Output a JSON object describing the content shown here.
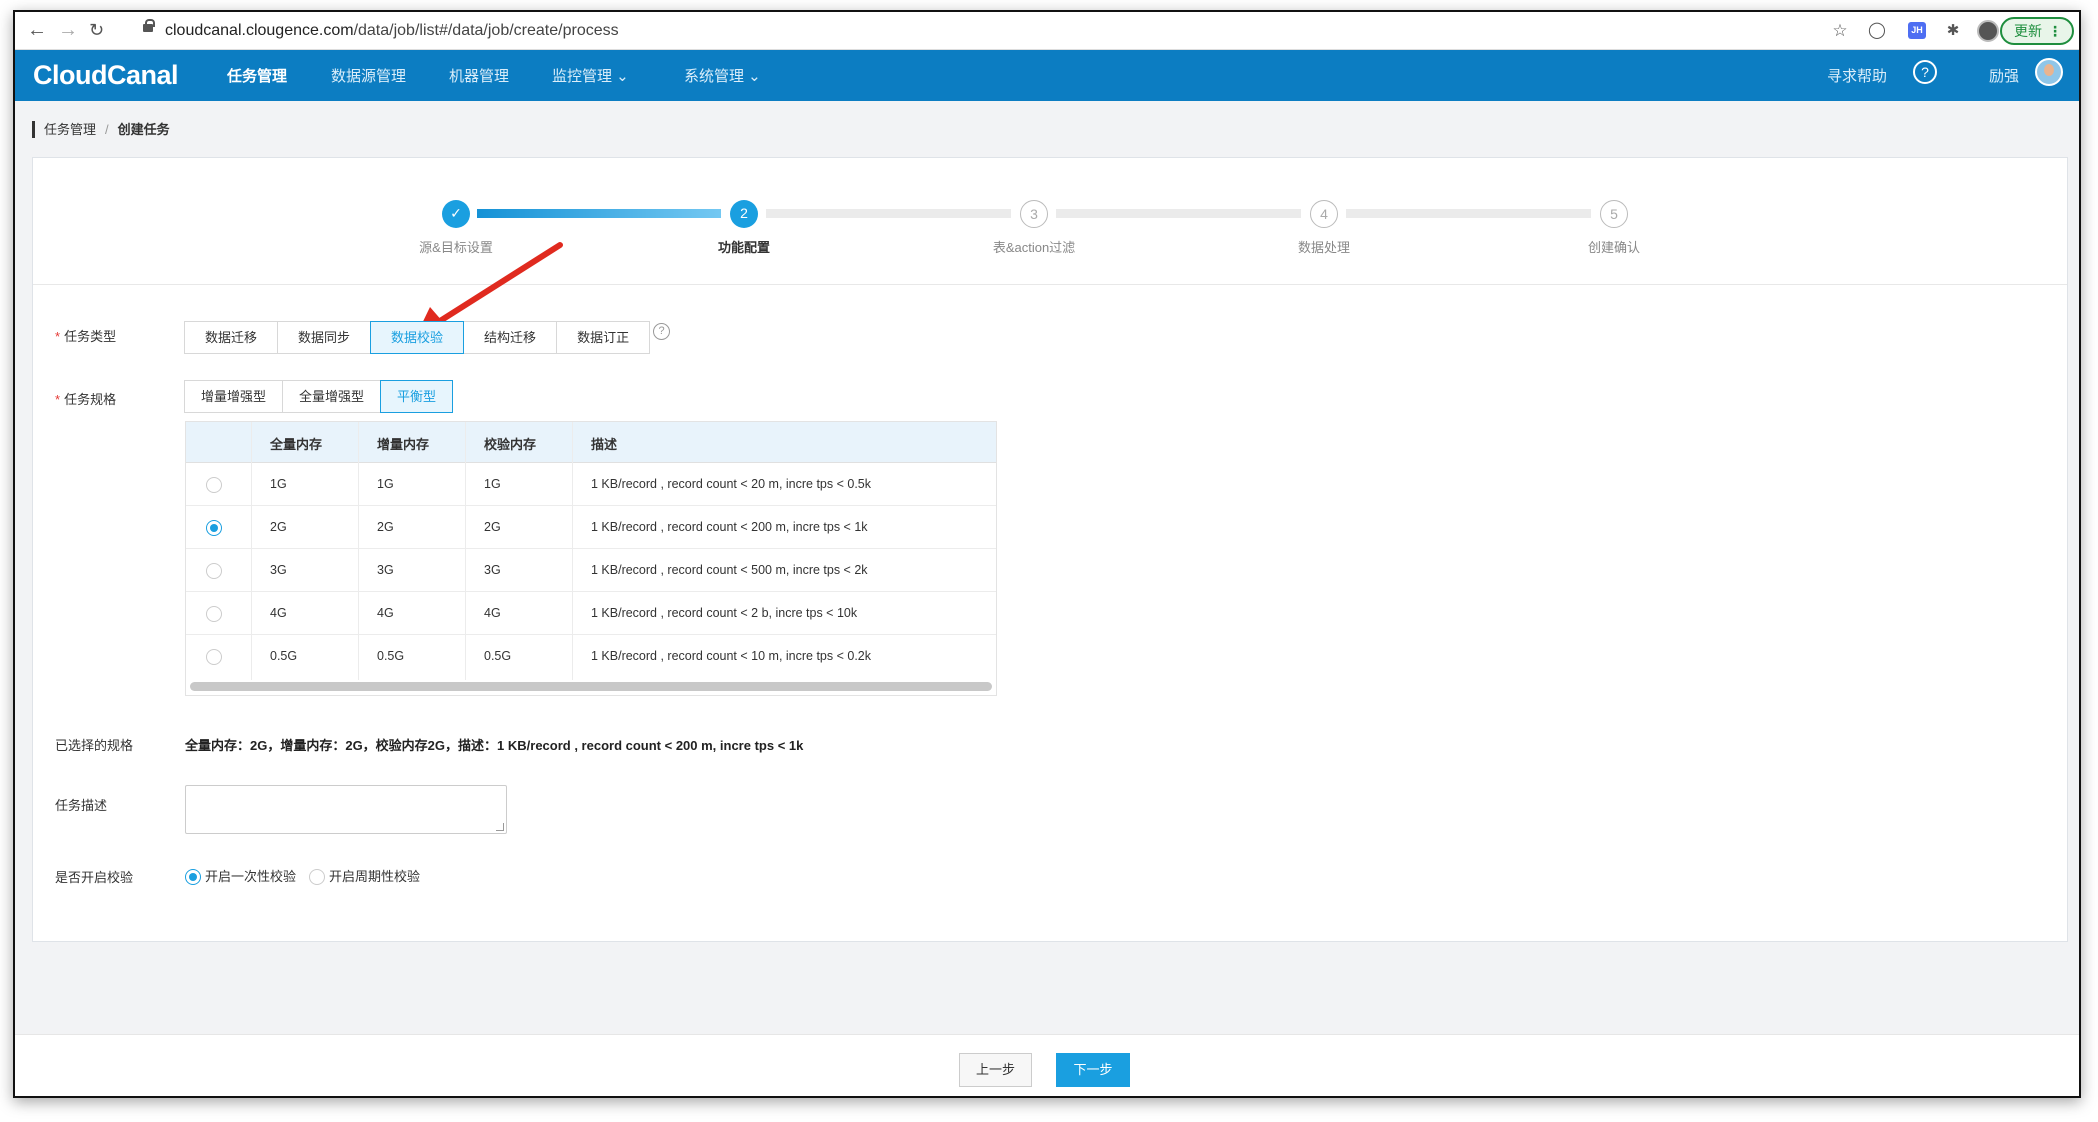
{
  "browser": {
    "url_host": "cloudcanal.clougence.com",
    "url_path": "/data/job/list#/data/job/create/process",
    "update_label": "更新"
  },
  "app": {
    "logo": "CloudCanal",
    "nav": [
      "任务管理",
      "数据源管理",
      "机器管理",
      "监控管理 ⌄",
      "系统管理 ⌄"
    ],
    "help_label": "寻求帮助",
    "user_name": "励强"
  },
  "breadcrumb": {
    "parent": "任务管理",
    "current": "创建任务"
  },
  "steps": [
    {
      "label": "源&目标设置",
      "num": "✓",
      "state": "done"
    },
    {
      "label": "功能配置",
      "num": "2",
      "state": "active"
    },
    {
      "label": "表&action过滤",
      "num": "3",
      "state": "todo"
    },
    {
      "label": "数据处理",
      "num": "4",
      "state": "todo"
    },
    {
      "label": "创建确认",
      "num": "5",
      "state": "todo"
    }
  ],
  "form": {
    "task_type_label": "任务类型",
    "task_types": [
      "数据迁移",
      "数据同步",
      "数据校验",
      "结构迁移",
      "数据订正"
    ],
    "task_type_selected": "数据校验",
    "task_spec_label": "任务规格",
    "task_specs": [
      "增量增强型",
      "全量增强型",
      "平衡型"
    ],
    "task_spec_selected": "平衡型",
    "table": {
      "headers": [
        "全量内存",
        "增量内存",
        "校验内存",
        "描述"
      ],
      "rows": [
        [
          "1G",
          "1G",
          "1G",
          "1 KB/record , record count < 20 m, incre tps < 0.5k"
        ],
        [
          "2G",
          "2G",
          "2G",
          "1 KB/record , record count < 200 m, incre tps < 1k"
        ],
        [
          "3G",
          "3G",
          "3G",
          "1 KB/record , record count < 500 m, incre tps < 2k"
        ],
        [
          "4G",
          "4G",
          "4G",
          "1 KB/record , record count < 2 b, incre tps < 10k"
        ],
        [
          "0.5G",
          "0.5G",
          "0.5G",
          "1 KB/record , record count < 10 m, incre tps < 0.2k"
        ]
      ],
      "selected_row": 1
    },
    "selected_spec_label": "已选择的规格",
    "selected_spec_text": "全量内存：2G，增量内存：2G，校验内存2G，描述：1 KB/record , record count < 200 m, incre tps < 1k",
    "desc_label": "任务描述",
    "desc_value": "",
    "verify_label": "是否开启校验",
    "verify_options": [
      "开启一次性校验",
      "开启周期性校验"
    ],
    "verify_selected": "开启一次性校验"
  },
  "footer": {
    "prev_label": "上一步",
    "next_label": "下一步"
  },
  "colors": {
    "header": "#0c7dc2",
    "accent": "#1a9fe0",
    "annotation_arrow": "#e02a1f"
  }
}
